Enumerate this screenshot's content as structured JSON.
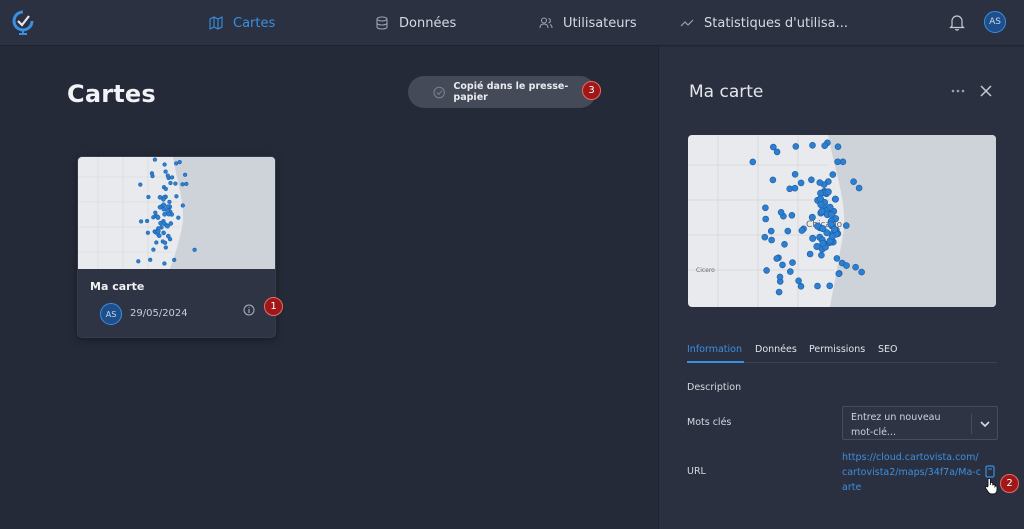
{
  "nav": {
    "items": [
      {
        "label": "Cartes",
        "icon": "map-icon",
        "active": true
      },
      {
        "label": "Données",
        "icon": "database-icon"
      },
      {
        "label": "Utilisateurs",
        "icon": "users-icon"
      },
      {
        "label": "Statistiques d'utilisa...",
        "icon": "stats-icon"
      }
    ],
    "user_initials": "AS"
  },
  "page": {
    "title": "Cartes"
  },
  "toast": {
    "message": "Copié dans le presse-papier"
  },
  "annotations": [
    "1",
    "2",
    "3"
  ],
  "card": {
    "title": "Ma carte",
    "owner_initials": "AS",
    "date": "29/05/2024"
  },
  "panel": {
    "title": "Ma carte",
    "map_label_city": "Chicago",
    "map_label_cicero": "Cicero",
    "tabs": [
      "Information",
      "Données",
      "Permissions",
      "SEO"
    ],
    "description_label": "Description",
    "keywords_label": "Mots clés",
    "keywords_placeholder": "Entrez un nouveau mot-clé...",
    "url_label": "URL",
    "url_value": "https://cloud.cartovista.com/cartovista2/maps/34f7a/Ma-carte"
  },
  "colors": {
    "accent": "#3b8fe0",
    "badge": "#a01717",
    "bg": "#252a38",
    "panel": "#2b3040"
  }
}
